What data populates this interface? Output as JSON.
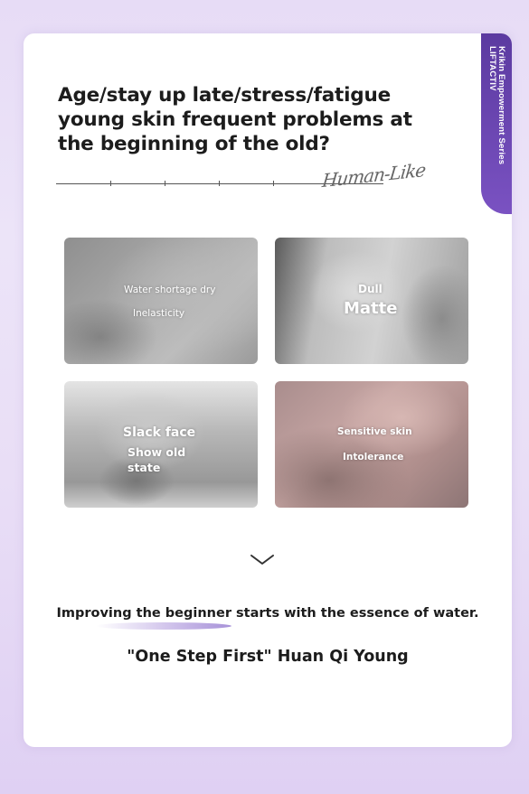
{
  "brand_ribbon": {
    "line1": "Krikin Empowerment Series",
    "line2": "LIFTACTIV"
  },
  "headline": "Age/stay up late/stress/fatigue young skin frequent problems at the beginning of the old?",
  "signature": "Human-Like",
  "photos": [
    {
      "name": "dry-skin-photo",
      "labels": [
        "Water shortage dry",
        "Inelasticity"
      ]
    },
    {
      "name": "dull-skin-photo",
      "labels": [
        "Dull",
        "Matte"
      ]
    },
    {
      "name": "slack-face-photo",
      "labels": [
        "Slack face",
        "Show old state"
      ]
    },
    {
      "name": "sensitive-skin-photo",
      "labels": [
        "Sensitive skin",
        "Intolerance"
      ]
    }
  ],
  "icons": {
    "scroll_indicator": "chevron-down-icon"
  },
  "tagline": "Improving the beginner starts with the essence of water.",
  "slogan": "\"One Step First\" Huan Qi Young",
  "colors": {
    "ribbon": "#5b3aa0",
    "background": "#e7dcf6",
    "text": "#1c1c1c"
  }
}
